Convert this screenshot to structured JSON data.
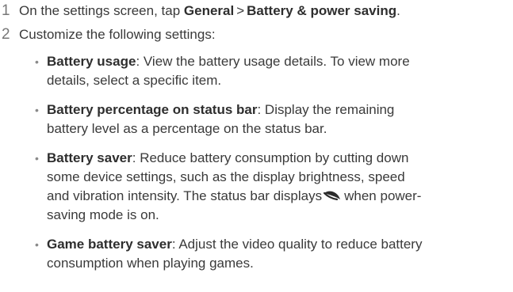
{
  "steps": [
    {
      "number": "1",
      "prefix": "On the settings screen, tap ",
      "path_1": "General",
      "separator": ">",
      "path_2": "Battery & power saving",
      "suffix": "."
    },
    {
      "number": "2",
      "text": "Customize the following settings:"
    }
  ],
  "bullets": [
    {
      "term": "Battery usage",
      "line_1": ": View the battery usage details. To view more",
      "line_2": "details, select a specific item."
    },
    {
      "term": "Battery percentage on status bar",
      "line_1": ": Display the remaining",
      "line_2": "battery level as a percentage on the status bar."
    },
    {
      "term": "Battery saver",
      "line_1": ": Reduce battery consumption by cutting down",
      "line_2": "some device settings, such as the display brightness, speed",
      "line_3": "and vibration intensity. The status bar displays",
      "line_3_icon": "leaf-icon",
      "line_3_after": "when power-",
      "line_4": "saving mode is on."
    },
    {
      "term": "Game battery saver",
      "line_1": ": Adjust the video quality to reduce battery",
      "line_2": "consumption when playing games."
    }
  ],
  "bullet_glyph": "•"
}
